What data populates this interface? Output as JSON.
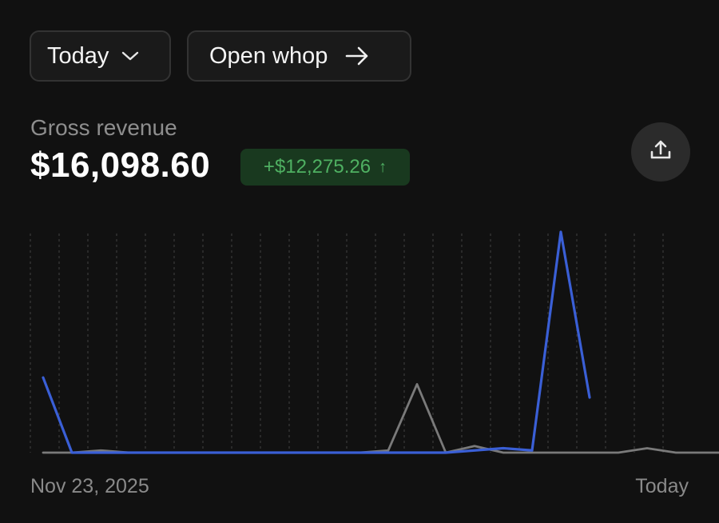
{
  "toolbar": {
    "period_label": "Today",
    "period_icon": "chevron-down-icon",
    "open_label": "Open whop",
    "open_icon": "arrow-right-icon"
  },
  "metric": {
    "label": "Gross revenue",
    "value": "$16,098.60",
    "delta": "+$12,275.26",
    "delta_icon": "arrow-up-icon",
    "delta_color": "#4fb062",
    "export_icon": "upload-icon"
  },
  "chart_data": {
    "type": "line",
    "x_start_label": "Nov 23, 2025",
    "x_end_label": "Today",
    "grid": "vertical-dashed",
    "series": [
      {
        "color": "#3a5fd6",
        "values": [
          0.34,
          0,
          0,
          0,
          0,
          0,
          0,
          0,
          0,
          0,
          0,
          0,
          0,
          0,
          0,
          0.01,
          0.02,
          0.01,
          1.0,
          0.25
        ]
      },
      {
        "color": "#7a7a7a",
        "values": [
          0,
          0,
          0.01,
          0,
          0,
          0,
          0,
          0,
          0,
          0,
          0,
          0,
          0.01,
          0.31,
          0,
          0.03,
          0,
          0,
          0,
          0,
          0,
          0.02,
          0,
          0,
          0
        ]
      }
    ]
  }
}
